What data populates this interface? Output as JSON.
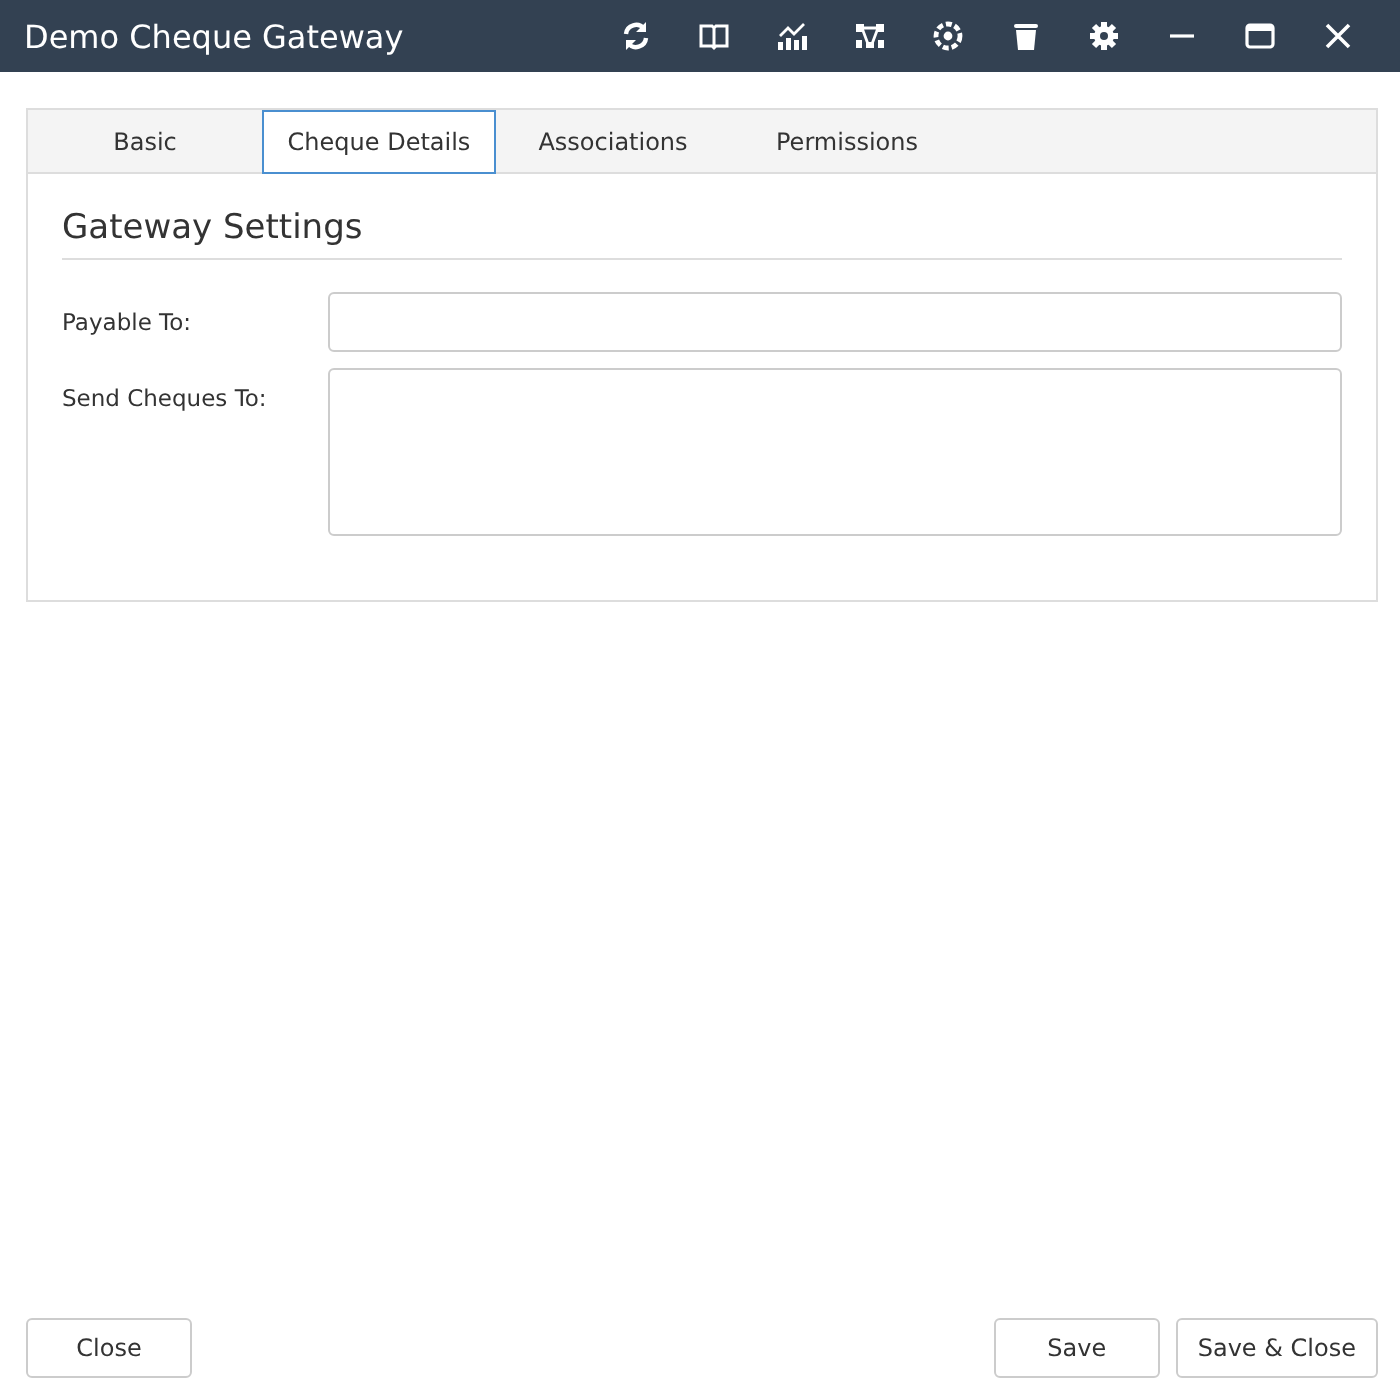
{
  "window": {
    "title": "Demo Cheque Gateway"
  },
  "tabs": [
    {
      "label": "Basic",
      "selected": false
    },
    {
      "label": "Cheque Details",
      "selected": true
    },
    {
      "label": "Associations",
      "selected": false
    },
    {
      "label": "Permissions",
      "selected": false
    }
  ],
  "section_title": "Gateway Settings",
  "fields": [
    {
      "label": "Payable To:",
      "kind": "text"
    },
    {
      "label": "Send Cheques To:",
      "kind": "textarea"
    }
  ],
  "footer": {
    "left_buttons": [
      "Close"
    ],
    "right_buttons": [
      "Save",
      "Save & Close"
    ]
  }
}
